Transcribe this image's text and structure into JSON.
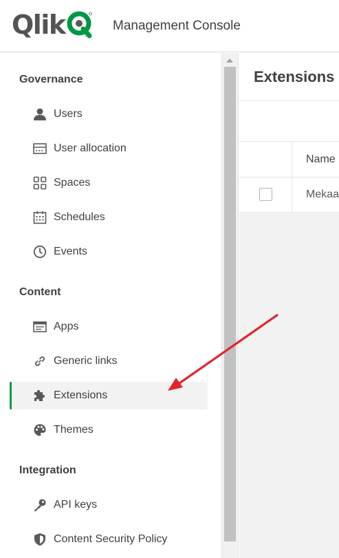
{
  "header": {
    "logo_text": "Qlik",
    "app_title": "Management Console",
    "brand_color": "#009845"
  },
  "sidebar": {
    "sections": [
      {
        "title": "Governance",
        "items": [
          {
            "label": "Users",
            "icon": "user-icon"
          },
          {
            "label": "User allocation",
            "icon": "user-allocation-icon"
          },
          {
            "label": "Spaces",
            "icon": "spaces-icon"
          },
          {
            "label": "Schedules",
            "icon": "calendar-icon"
          },
          {
            "label": "Events",
            "icon": "clock-icon"
          }
        ]
      },
      {
        "title": "Content",
        "items": [
          {
            "label": "Apps",
            "icon": "apps-icon"
          },
          {
            "label": "Generic links",
            "icon": "link-icon"
          },
          {
            "label": "Extensions",
            "icon": "puzzle-icon",
            "active": true
          },
          {
            "label": "Themes",
            "icon": "palette-icon"
          }
        ]
      },
      {
        "title": "Integration",
        "items": [
          {
            "label": "API keys",
            "icon": "key-icon"
          },
          {
            "label": "Content Security Policy",
            "icon": "shield-icon"
          }
        ]
      }
    ]
  },
  "main": {
    "title": "Extensions",
    "table": {
      "columns": [
        "Name"
      ],
      "rows": [
        {
          "name": "Mekaa"
        }
      ]
    }
  },
  "annotation": {
    "type": "arrow",
    "color": "#e0262d"
  }
}
